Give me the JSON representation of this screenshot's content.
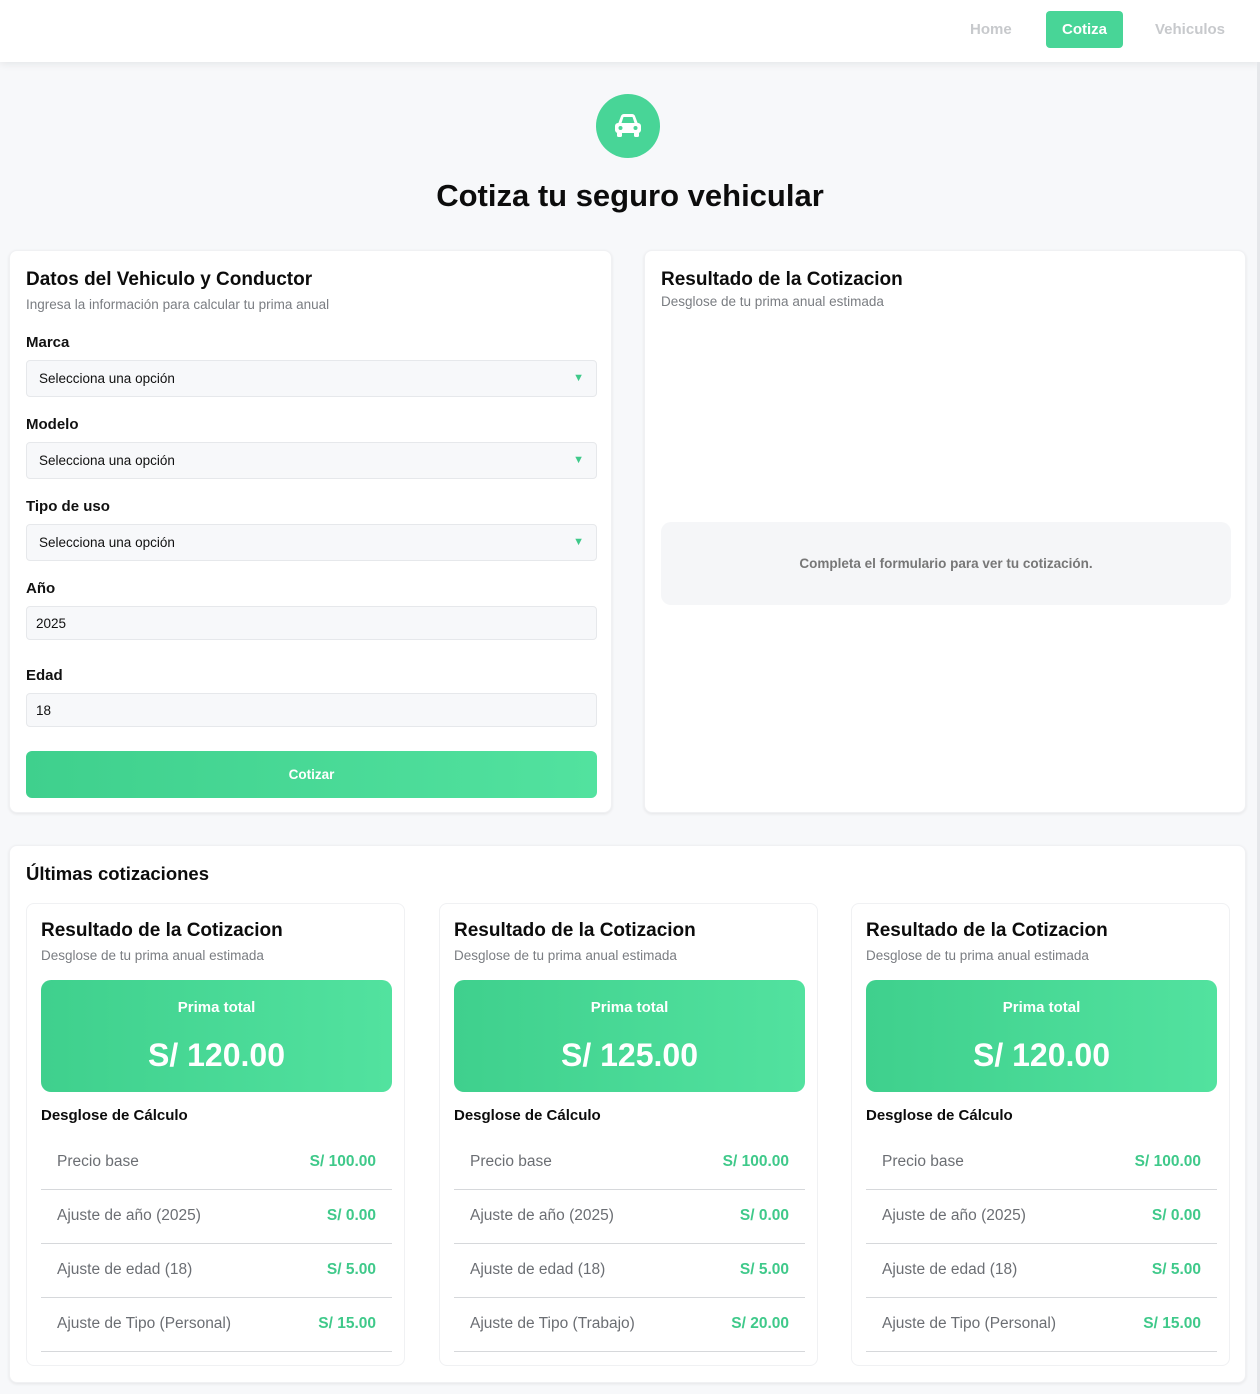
{
  "nav": {
    "items": [
      {
        "label": "Home",
        "active": false
      },
      {
        "label": "Cotiza",
        "active": true
      },
      {
        "label": "Vehiculos",
        "active": false
      }
    ]
  },
  "hero": {
    "icon": "car-icon",
    "title": "Cotiza tu seguro vehicular"
  },
  "form": {
    "title": "Datos del Vehiculo y Conductor",
    "subtitle": "Ingresa la información para calcular tu prima anual",
    "fields": {
      "marca": {
        "label": "Marca",
        "value": "Selecciona una opción"
      },
      "modelo": {
        "label": "Modelo",
        "value": "Selecciona una opción"
      },
      "tipo": {
        "label": "Tipo de uso",
        "value": "Selecciona una opción"
      },
      "anio": {
        "label": "Año",
        "value": "2025"
      },
      "edad": {
        "label": "Edad",
        "value": "18"
      }
    },
    "submit_label": "Cotizar"
  },
  "result": {
    "title": "Resultado de la Cotizacion",
    "subtitle": "Desglose de tu prima anual estimada",
    "empty_message": "Completa el formulario para ver tu cotización."
  },
  "history": {
    "title": "Últimas cotizaciones",
    "cards": [
      {
        "title": "Resultado de la Cotizacion",
        "subtitle": "Desglose de tu prima anual estimada",
        "total_label": "Prima total",
        "total": "S/ 120.00",
        "breakdown_title": "Desglose de Cálculo",
        "rows": [
          {
            "label": "Precio base",
            "value": "S/ 100.00"
          },
          {
            "label": "Ajuste de año (2025)",
            "value": "S/ 0.00"
          },
          {
            "label": "Ajuste de edad (18)",
            "value": "S/ 5.00"
          },
          {
            "label": "Ajuste de Tipo (Personal)",
            "value": "S/ 15.00"
          }
        ]
      },
      {
        "title": "Resultado de la Cotizacion",
        "subtitle": "Desglose de tu prima anual estimada",
        "total_label": "Prima total",
        "total": "S/ 125.00",
        "breakdown_title": "Desglose de Cálculo",
        "rows": [
          {
            "label": "Precio base",
            "value": "S/ 100.00"
          },
          {
            "label": "Ajuste de año (2025)",
            "value": "S/ 0.00"
          },
          {
            "label": "Ajuste de edad (18)",
            "value": "S/ 5.00"
          },
          {
            "label": "Ajuste de Tipo (Trabajo)",
            "value": "S/ 20.00"
          }
        ]
      },
      {
        "title": "Resultado de la Cotizacion",
        "subtitle": "Desglose de tu prima anual estimada",
        "total_label": "Prima total",
        "total": "S/ 120.00",
        "breakdown_title": "Desglose de Cálculo",
        "rows": [
          {
            "label": "Precio base",
            "value": "S/ 100.00"
          },
          {
            "label": "Ajuste de año (2025)",
            "value": "S/ 0.00"
          },
          {
            "label": "Ajuste de edad (18)",
            "value": "S/ 5.00"
          },
          {
            "label": "Ajuste de Tipo (Personal)",
            "value": "S/ 15.00"
          }
        ]
      }
    ]
  },
  "colors": {
    "accent": "#48d597",
    "accent_text": "#3fc98a",
    "background": "#f7f8fa"
  }
}
